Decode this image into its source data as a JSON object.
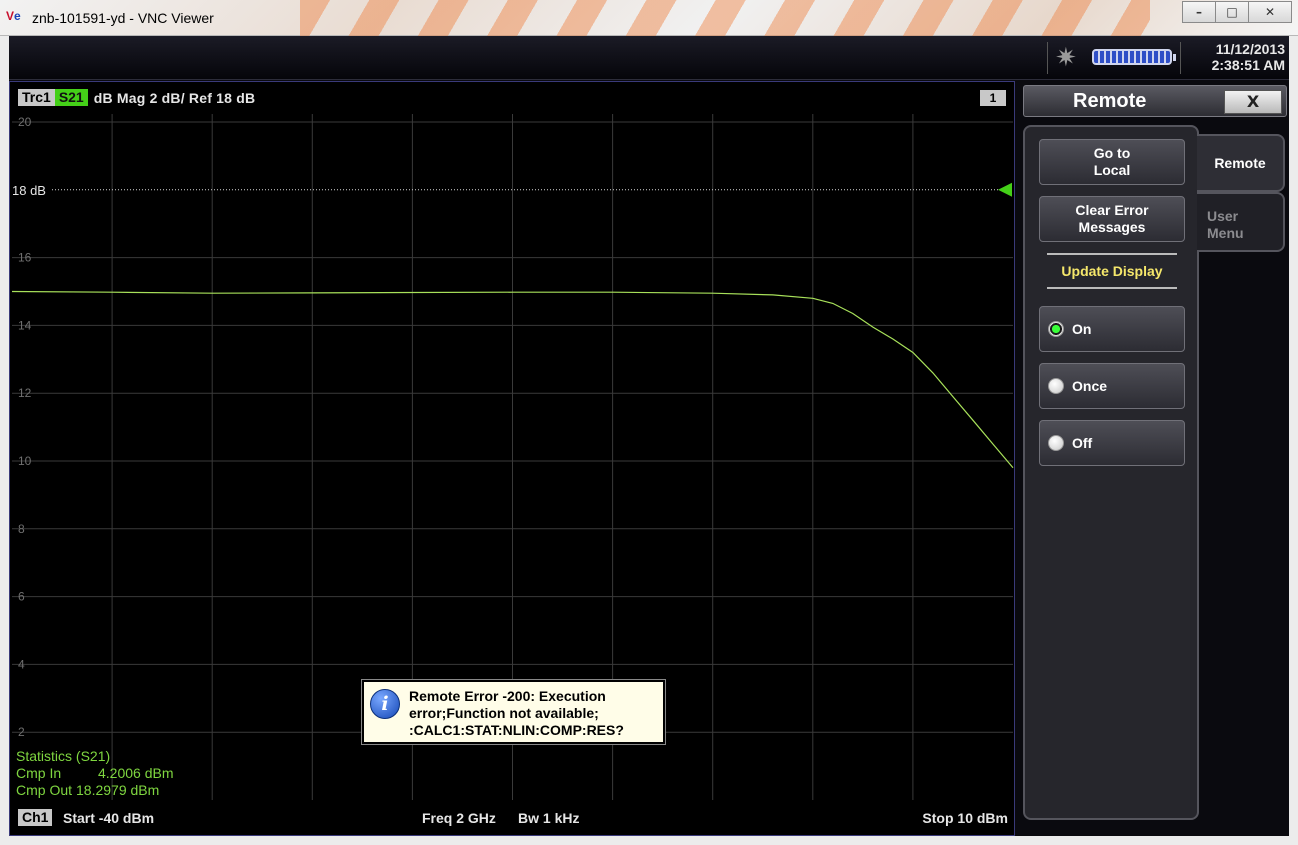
{
  "window": {
    "title": "znb-101591-yd - VNC Viewer",
    "icon_text_a": "V",
    "icon_text_b": "e",
    "minimize": "–",
    "maximize": "□",
    "close": "✕"
  },
  "topbar": {
    "date": "11/12/2013",
    "time": "2:38:51 AM",
    "hw_icon": "star-burst-icon",
    "battery_icon": "battery-icon"
  },
  "trace": {
    "trace_name": "Trc1",
    "param": "S21",
    "info": "dB Mag  2 dB/ Ref 18 dB",
    "window_number": "1",
    "ref_label": "18 dB"
  },
  "chart_data": {
    "type": "line",
    "xlabel": "",
    "ylabel": "",
    "x_start_label": "Start -40 dBm",
    "x_stop_label": "Stop 10 dBm",
    "x_range": [
      -40,
      10
    ],
    "ylim": [
      0,
      20
    ],
    "yticks": [
      20,
      18,
      16,
      14,
      12,
      10,
      8,
      6,
      4,
      2
    ],
    "reference_value": 18,
    "grid": true,
    "series": [
      {
        "x": [
          -40,
          -35,
          -30,
          -25,
          -20,
          -15,
          -10,
          -5,
          -2,
          0,
          1,
          2,
          3,
          4,
          5,
          6,
          7,
          8,
          9,
          10
        ],
        "values": [
          15.0,
          14.98,
          14.95,
          14.96,
          14.97,
          14.98,
          14.98,
          14.95,
          14.9,
          14.8,
          14.65,
          14.35,
          13.95,
          13.6,
          13.2,
          12.6,
          11.9,
          11.2,
          10.5,
          9.8
        ]
      }
    ],
    "color": "#a8e15a"
  },
  "stats": {
    "title": "Statistics  (S21)",
    "cmp_in_label": "Cmp In",
    "cmp_in_value": "4.2006 dBm",
    "cmp_out_label": "Cmp Out",
    "cmp_out_value": "18.2979 dBm"
  },
  "footer": {
    "channel": "Ch1",
    "start": "Start  -40 dBm",
    "freq": "Freq  2 GHz",
    "bw": "Bw  1 kHz",
    "stop": "Stop  10 dBm"
  },
  "error": {
    "line1": "Remote Error -200: Execution",
    "line2": "error;Function not available;",
    "line3": ":CALC1:STAT:NLIN:COMP:RES?",
    "icon": "i"
  },
  "panel": {
    "title": "Remote",
    "close": "X",
    "tab_remote": "Remote",
    "tab_user_menu_1": "User",
    "tab_user_menu_2": "Menu",
    "go_to_local_1": "Go to",
    "go_to_local_2": "Local",
    "clear_err_1": "Clear Error",
    "clear_err_2": "Messages",
    "update_display": "Update Display",
    "opt_on": "On",
    "opt_once": "Once",
    "opt_off": "Off"
  }
}
